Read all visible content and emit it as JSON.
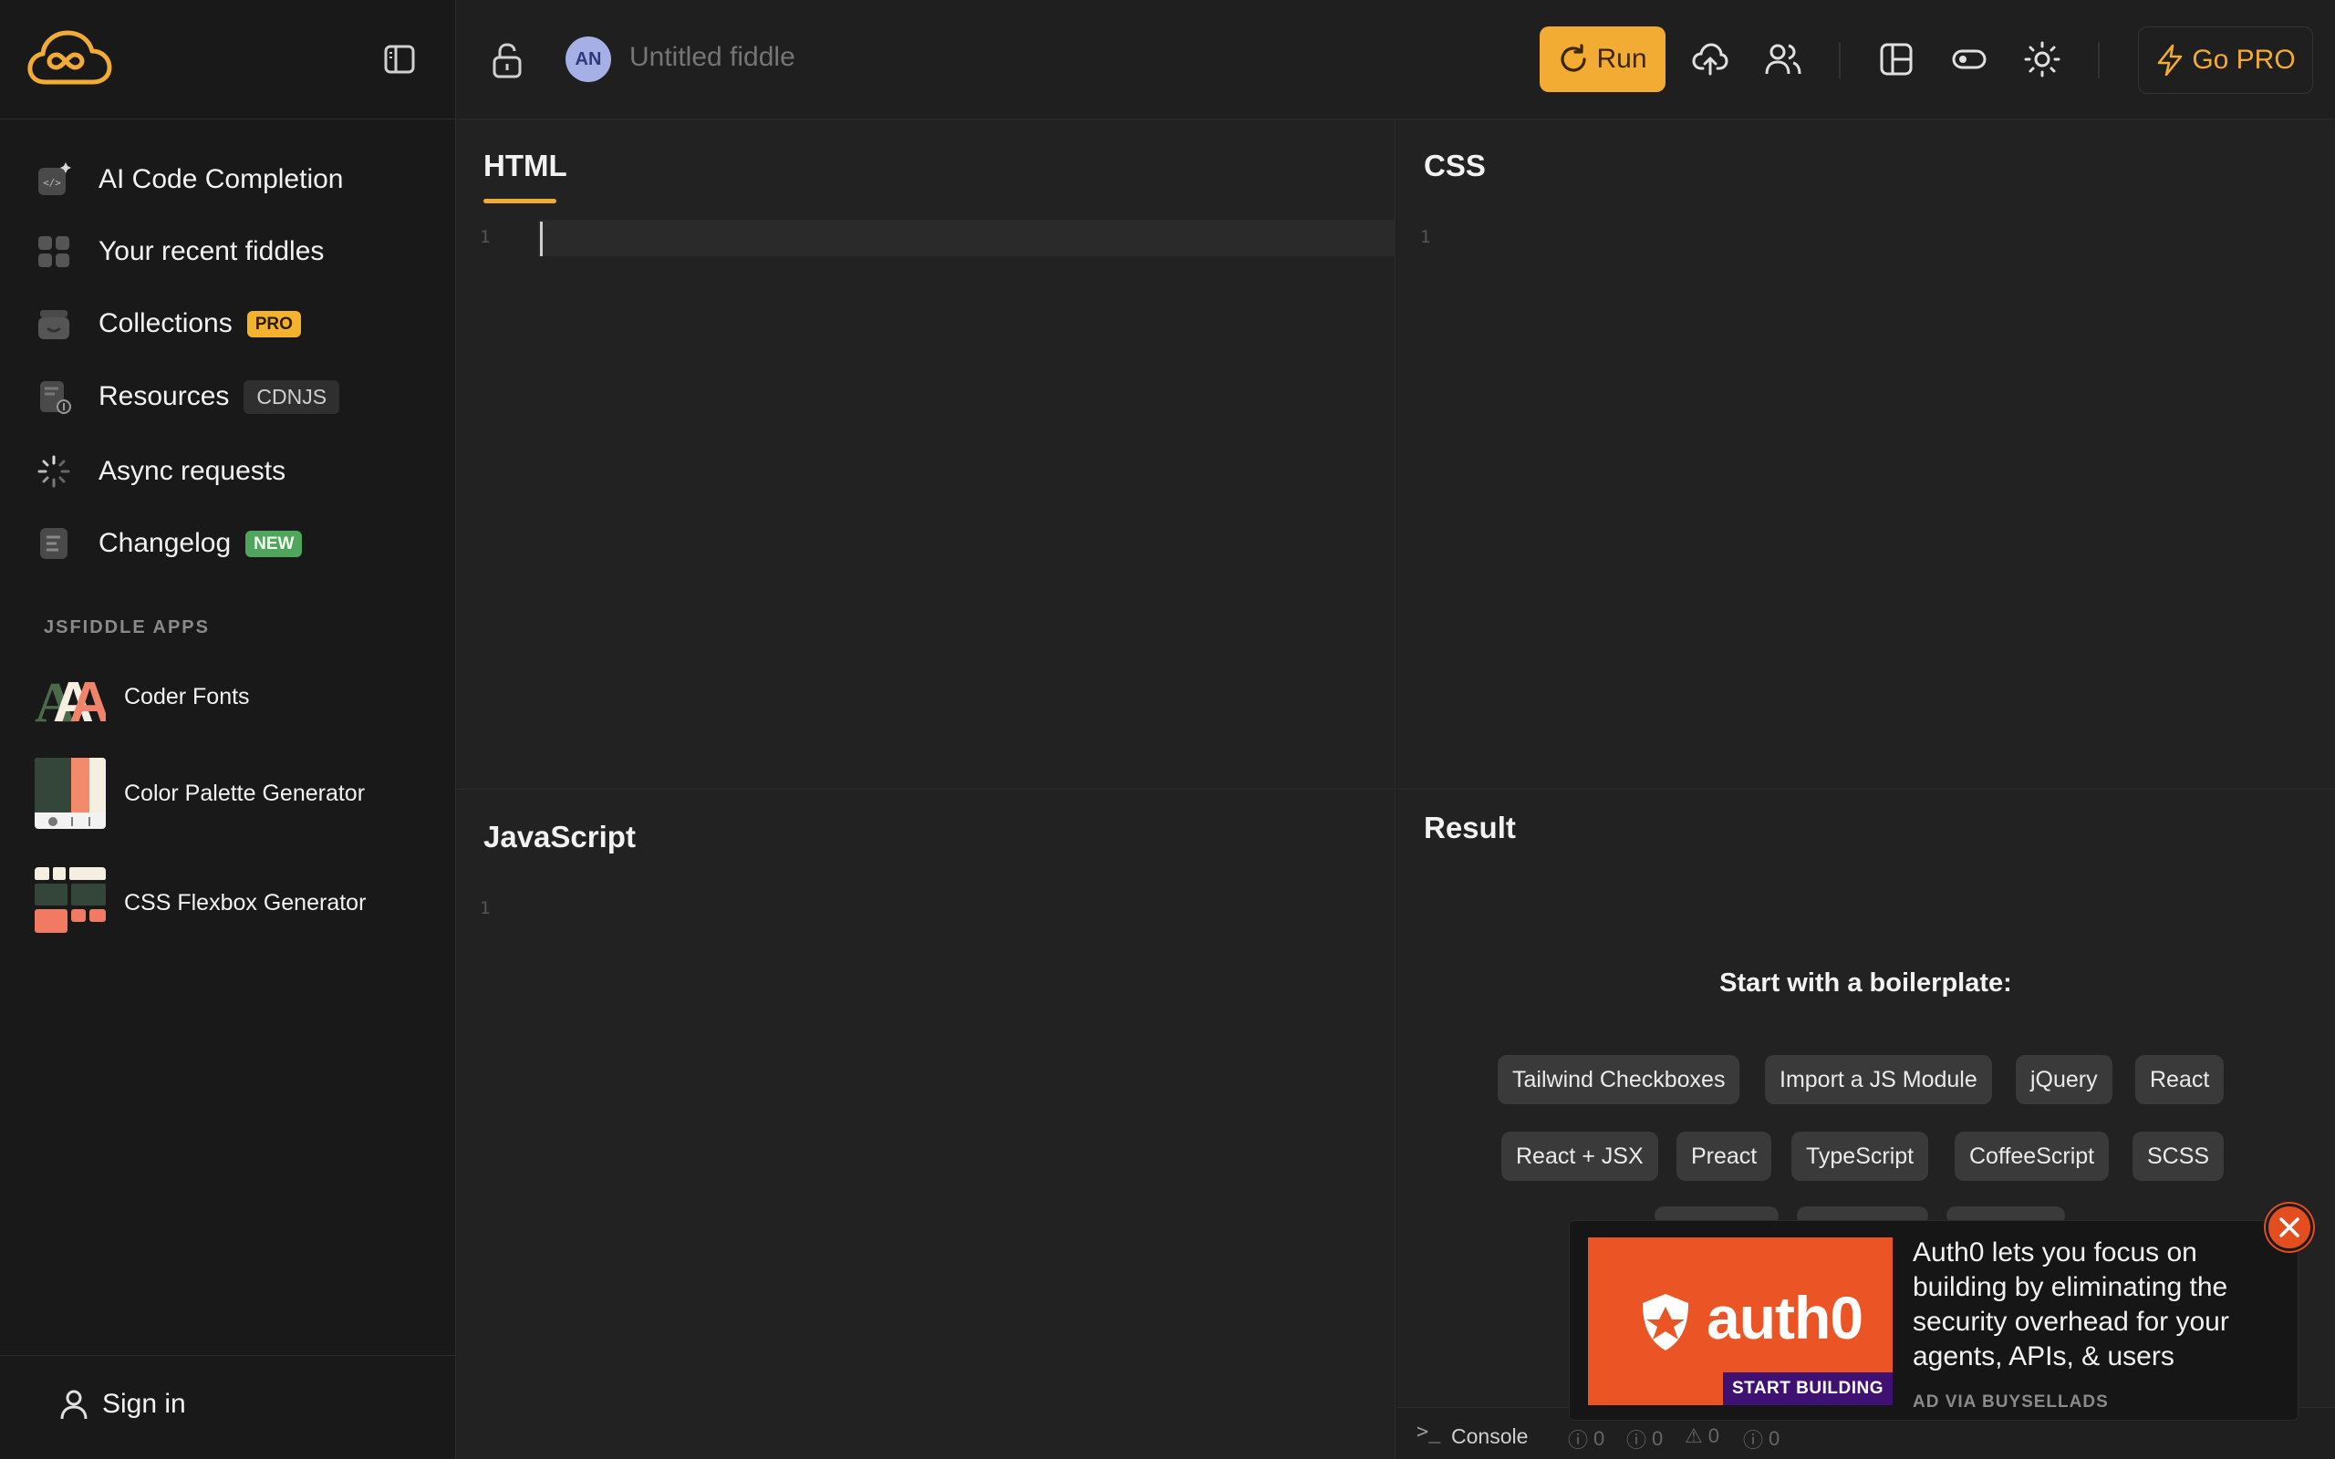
{
  "sidebar": {
    "items": [
      {
        "label": "AI Code Completion",
        "icon": "ai-code-icon"
      },
      {
        "label": "Your recent fiddles",
        "icon": "grid-icon"
      },
      {
        "label": "Collections",
        "icon": "collections-icon",
        "badge": "PRO"
      },
      {
        "label": "Resources",
        "icon": "resources-icon",
        "badge": "CDNJS"
      },
      {
        "label": "Async requests",
        "icon": "spinner-icon"
      },
      {
        "label": "Changelog",
        "icon": "changelog-icon",
        "badge": "NEW"
      }
    ],
    "apps_title": "JSFIDDLE APPS",
    "apps": [
      {
        "label": "Coder Fonts"
      },
      {
        "label": "Color Palette Generator"
      },
      {
        "label": "CSS Flexbox Generator"
      }
    ],
    "signin": "Sign in"
  },
  "header": {
    "avatar": "AN",
    "title_placeholder": "Untitled fiddle",
    "run": "Run",
    "gopro": "Go PRO"
  },
  "panels": {
    "html": {
      "title": "HTML",
      "line": "1"
    },
    "css": {
      "title": "CSS",
      "line": "1"
    },
    "js": {
      "title": "JavaScript",
      "line": "1"
    },
    "result": {
      "title": "Result"
    }
  },
  "boilerplate": {
    "title": "Start with a boilerplate:",
    "row1": [
      "Tailwind Checkboxes",
      "Import a JS Module",
      "jQuery",
      "React"
    ],
    "row2": [
      "React + JSX",
      "Preact",
      "TypeScript",
      "CoffeeScript",
      "SCSS"
    ]
  },
  "console": {
    "label": "Console",
    "prompt": ">_",
    "counts": [
      "0",
      "0",
      "0",
      "0"
    ]
  },
  "ad": {
    "brand": "auth0",
    "cta": "START BUILDING",
    "text": "Auth0 lets you focus on building by eliminating the security overhead for your agents, APIs, & users",
    "via": "AD VIA BUYSELLADS"
  },
  "colors": {
    "accent": "#f2ac33",
    "pro_badge": "#f5b22d",
    "new_badge": "#4fa55c",
    "ad_bg": "#eb5424",
    "ad_cta": "#3f1173"
  }
}
